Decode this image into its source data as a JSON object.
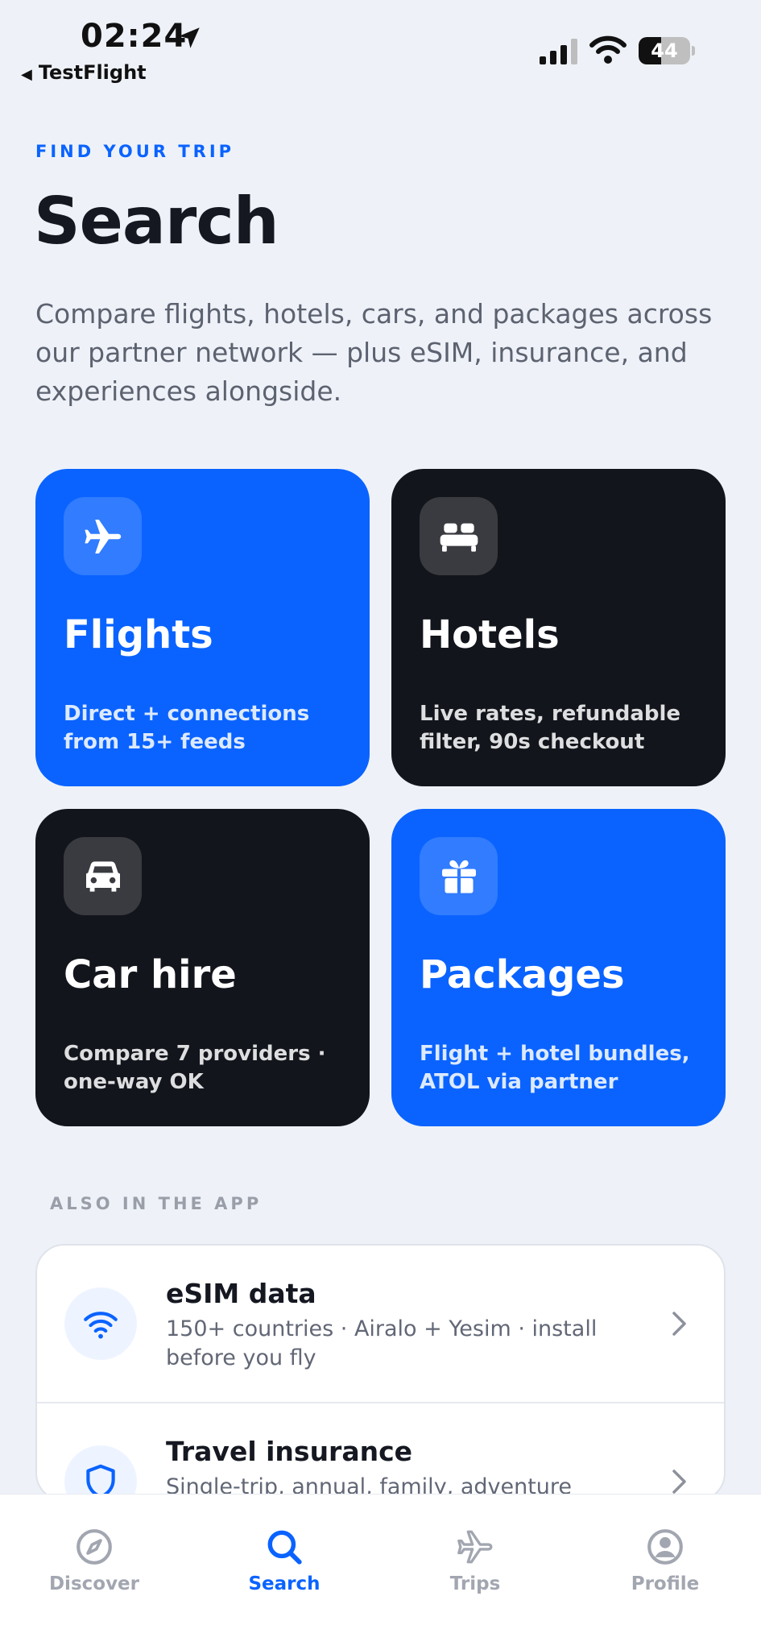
{
  "status_bar": {
    "time": "02:24",
    "back_app": "TestFlight",
    "battery_level": "44",
    "battery_fraction": 0.44
  },
  "header": {
    "eyebrow": "FIND YOUR TRIP",
    "title": "Search",
    "subtitle": "Compare flights, hotels, cars, and packages across our partner network — plus eSIM, insurance, and experiences alongside."
  },
  "cards": [
    {
      "name": "Flights",
      "desc": "Direct + connections from 15+ feeds",
      "icon": "airplane-icon",
      "theme": "blue"
    },
    {
      "name": "Hotels",
      "desc": "Live rates, refundable filter, 90s checkout",
      "icon": "bed-icon",
      "theme": "dark"
    },
    {
      "name": "Car hire",
      "desc": "Compare 7 providers · one-way OK",
      "icon": "car-icon",
      "theme": "dark"
    },
    {
      "name": "Packages",
      "desc": "Flight + hotel bundles, ATOL via partner",
      "icon": "gift-icon",
      "theme": "blue"
    }
  ],
  "also": {
    "label": "ALSO IN THE APP",
    "items": [
      {
        "title": "eSIM data",
        "desc": "150+ countries · Airalo + Yesim · install before you fly",
        "icon": "wifi-icon"
      },
      {
        "title": "Travel insurance",
        "desc": "Single-trip, annual, family, adventure",
        "icon": "shield-icon"
      }
    ]
  },
  "tabs": [
    {
      "label": "Discover",
      "icon": "compass-icon",
      "active": false
    },
    {
      "label": "Search",
      "icon": "search-icon",
      "active": true
    },
    {
      "label": "Trips",
      "icon": "airplane-icon",
      "active": false
    },
    {
      "label": "Profile",
      "icon": "user-icon",
      "active": false
    }
  ],
  "colors": {
    "accent": "#0a63ff",
    "dark_card": "#13151c",
    "background": "#eef2f8"
  }
}
